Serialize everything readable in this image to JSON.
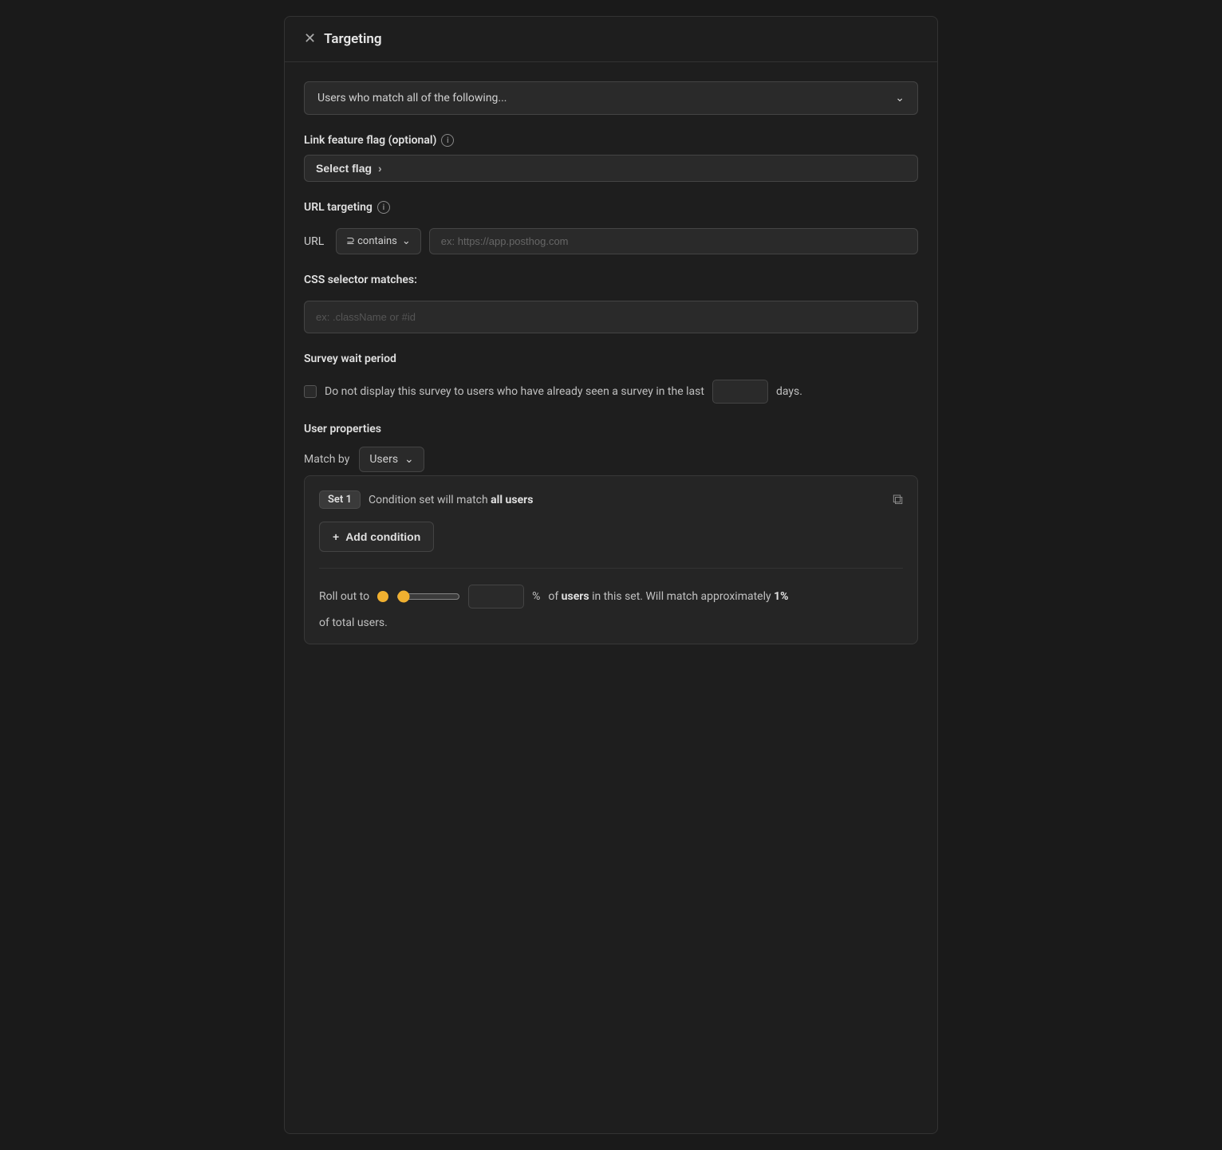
{
  "panel": {
    "title": "Targeting",
    "header_icon": "×"
  },
  "users_match": {
    "dropdown_label": "Users who match all of the following...",
    "chevron": "⌄"
  },
  "link_flag": {
    "section_label": "Link feature flag (optional)",
    "button_label": "Select flag",
    "info_icon": "i"
  },
  "url_targeting": {
    "section_label": "URL targeting",
    "url_label": "URL",
    "contains_label": "⊇ contains",
    "url_placeholder": "ex: https://app.posthog.com",
    "info_icon": "i"
  },
  "css_selector": {
    "section_label": "CSS selector matches:",
    "placeholder": "ex: .className or #id"
  },
  "survey_wait": {
    "section_label": "Survey wait period",
    "checkbox_text": "Do not display this survey to users who have already seen a survey in the last",
    "days_suffix": "days.",
    "days_value": ""
  },
  "user_properties": {
    "section_label": "User properties",
    "match_by_label": "Match by",
    "users_option": "Users"
  },
  "condition_set": {
    "set_badge": "Set 1",
    "description_prefix": "Condition set will match ",
    "description_bold": "all users",
    "copy_icon": "⧉"
  },
  "add_condition": {
    "button_label": "Add condition",
    "plus": "+"
  },
  "rollout": {
    "label": "Roll out to",
    "value": "1",
    "percent": "%",
    "description_prefix": "of ",
    "description_bold_users": "users",
    "description_suffix": " in this set. Will match approximately ",
    "description_bold_pct": "1%",
    "description_2": "of total users."
  }
}
